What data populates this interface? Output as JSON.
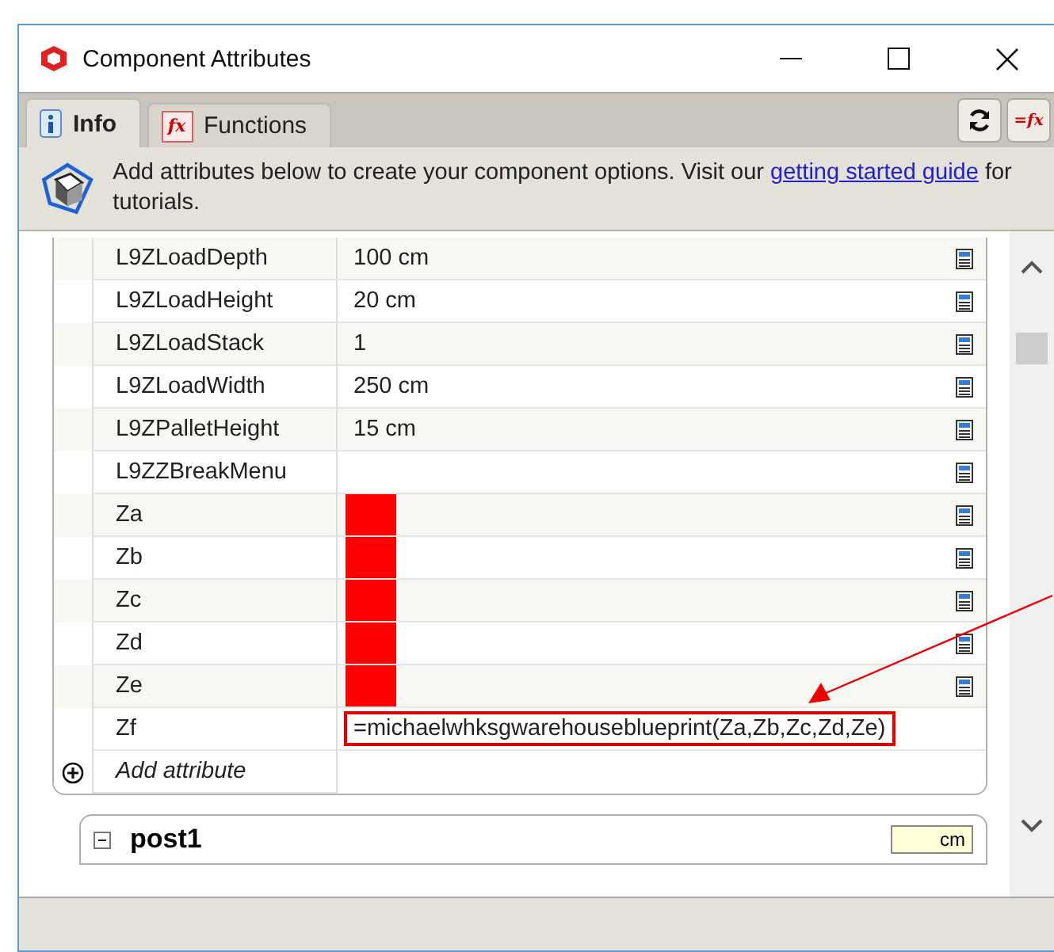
{
  "window": {
    "title": "Component Attributes"
  },
  "tabs": [
    {
      "label": "Info",
      "selected": true,
      "kind": "info"
    },
    {
      "label": "Functions",
      "selected": false,
      "kind": "functions",
      "icon_text": "fx"
    }
  ],
  "toolbar": {
    "formula_label": "=fx"
  },
  "banner": {
    "text": "Add attributes below to create your component options. Visit our ",
    "link": "getting started guide",
    "suffix": " for tutorials."
  },
  "attributes": [
    {
      "name": "L9ZLoadDepth",
      "value": "100 cm",
      "redacted": false,
      "highlighted": false
    },
    {
      "name": "L9ZLoadHeight",
      "value": "20 cm",
      "redacted": false,
      "highlighted": false
    },
    {
      "name": "L9ZLoadStack",
      "value": "1",
      "redacted": false,
      "highlighted": false
    },
    {
      "name": "L9ZLoadWidth",
      "value": "250 cm",
      "redacted": false,
      "highlighted": false
    },
    {
      "name": "L9ZPalletHeight",
      "value": "15 cm",
      "redacted": false,
      "highlighted": false
    },
    {
      "name": "L9ZZBreakMenu",
      "redacted": false,
      "highlighted": false
    },
    {
      "name": "Za",
      "redacted": true,
      "highlighted": false
    },
    {
      "name": "Zb",
      "redacted": true,
      "highlighted": false
    },
    {
      "name": "Zc",
      "redacted": true,
      "highlighted": false
    },
    {
      "name": "Zd",
      "redacted": true,
      "highlighted": false
    },
    {
      "name": "Ze",
      "redacted": true,
      "highlighted": false
    },
    {
      "name": "Zf",
      "value": "=michaelwhksgwarehouseblueprint(Za,Zb,Zc,Zd,Ze)",
      "redacted": false,
      "highlighted": true
    }
  ],
  "add_attribute": {
    "label": "Add attribute"
  },
  "next_section": {
    "title": "post1",
    "unit": "cm"
  }
}
